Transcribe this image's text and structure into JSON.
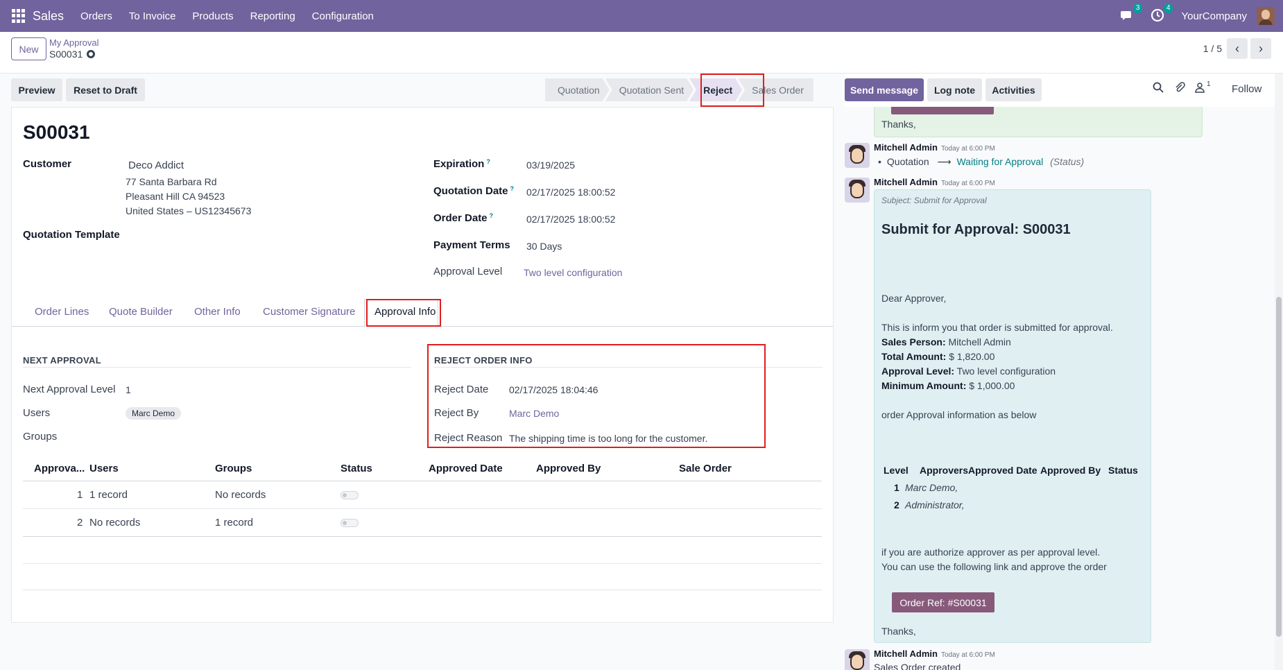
{
  "navbar": {
    "app_name": "Sales",
    "menu": [
      "Orders",
      "To Invoice",
      "Products",
      "Reporting",
      "Configuration"
    ],
    "messages_count": "3",
    "activities_count": "4",
    "company": "YourCompany"
  },
  "control": {
    "new_label": "New",
    "breadcrumb_parent": "My Approval",
    "breadcrumb_current": "S00031",
    "pager": "1 / 5"
  },
  "actions": {
    "preview": "Preview",
    "reset_to_draft": "Reset to Draft"
  },
  "statusbar": {
    "stages": [
      "Quotation",
      "Quotation Sent",
      "Reject",
      "Sales Order"
    ],
    "active": "Reject"
  },
  "form": {
    "title": "S00031",
    "customer_label": "Customer",
    "customer_name": "Deco Addict",
    "customer_address": [
      "77 Santa Barbara Rd",
      "Pleasant Hill CA 94523",
      "United States – US12345673"
    ],
    "quotation_template_label": "Quotation Template",
    "expiration_label": "Expiration",
    "expiration": "03/19/2025",
    "quotation_date_label": "Quotation Date",
    "quotation_date": "02/17/2025 18:00:52",
    "order_date_label": "Order Date",
    "order_date": "02/17/2025 18:00:52",
    "payment_terms_label": "Payment Terms",
    "payment_terms": "30 Days",
    "approval_level_label": "Approval Level",
    "approval_level": "Two level configuration",
    "help_mark": "?"
  },
  "tabs": [
    "Order Lines",
    "Quote Builder",
    "Other Info",
    "Customer Signature",
    "Approval Info"
  ],
  "next_approval": {
    "title": "NEXT APPROVAL",
    "level_label": "Next Approval Level",
    "level": "1",
    "users_label": "Users",
    "users_tag": "Marc Demo",
    "groups_label": "Groups"
  },
  "reject_info": {
    "title": "REJECT ORDER INFO",
    "date_label": "Reject Date",
    "date": "02/17/2025 18:04:46",
    "by_label": "Reject By",
    "by": "Marc Demo",
    "reason_label": "Reject Reason",
    "reason": "The shipping time is too long for the customer."
  },
  "approval_table": {
    "headers": [
      "Approva...",
      "Users",
      "Groups",
      "Status",
      "Approved Date",
      "Approved By",
      "Sale Order"
    ],
    "rows": [
      {
        "level": "1",
        "users": "1 record",
        "groups": "No records"
      },
      {
        "level": "2",
        "users": "No records",
        "groups": "1 record"
      }
    ]
  },
  "chatter": {
    "send_message": "Send message",
    "log_note": "Log note",
    "activities": "Activities",
    "followers_count": "1",
    "follow": "Follow",
    "top_thanks": "Thanks,",
    "messages": [
      {
        "author": "Mitchell Admin",
        "time": "Today at 6:00 PM",
        "old_value": "Quotation",
        "arrow": "⟶",
        "new_value": "Waiting for Approval",
        "field": "(Status)"
      },
      {
        "author": "Mitchell Admin",
        "time": "Today at 6:00 PM",
        "subject": "Subject: Submit for Approval",
        "heading": "Submit for Approval: S00031",
        "greeting": "Dear Approver,",
        "intro": "This is inform you that order is submitted for approval.",
        "sales_person_label": "Sales Person:",
        "sales_person": "Mitchell Admin",
        "total_amount_label": "Total Amount:",
        "total_amount": "$ 1,820.00",
        "approval_level_label": "Approval Level:",
        "approval_level": "Two level configuration",
        "minimum_amount_label": "Minimum Amount:",
        "minimum_amount": "$ 1,000.00",
        "info_line": "order Approval information as below",
        "table_headers": [
          "Level",
          "Approvers",
          "Approved Date",
          "Approved By",
          "Status"
        ],
        "table_rows": [
          {
            "level": "1",
            "approvers": "Marc Demo,"
          },
          {
            "level": "2",
            "approvers": "Administrator,"
          }
        ],
        "closing_1": "if you are authorize approver as per approval level.",
        "closing_2": "You can use the following link and approve the order",
        "order_button": "Order Ref: #S00031",
        "thanks": "Thanks,"
      },
      {
        "author": "Mitchell Admin",
        "time": "Today at 6:00 PM",
        "body": "Sales Order created"
      }
    ]
  }
}
